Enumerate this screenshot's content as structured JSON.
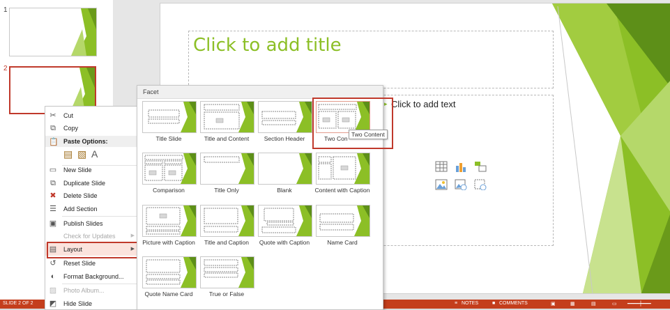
{
  "thumbnails": [
    {
      "number": "1",
      "selected": false
    },
    {
      "number": "2",
      "selected": true
    }
  ],
  "slide": {
    "title_placeholder": "Click to add title",
    "body_placeholder": "Click to add text",
    "content_icons": [
      "table-icon",
      "chart-icon",
      "smartart-icon",
      "picture-icon",
      "online-picture-icon",
      "video-icon"
    ]
  },
  "context_menu": {
    "items": [
      {
        "label": "Cut",
        "icon": "scissors-icon",
        "enabled": true
      },
      {
        "label": "Copy",
        "icon": "copy-icon",
        "enabled": true
      },
      {
        "label": "Paste Options:",
        "icon": "paste-icon",
        "enabled": true
      },
      {
        "label": "New Slide",
        "icon": "new-slide-icon",
        "enabled": true
      },
      {
        "label": "Duplicate Slide",
        "icon": "duplicate-icon",
        "enabled": true
      },
      {
        "label": "Delete Slide",
        "icon": "delete-slide-icon",
        "enabled": true
      },
      {
        "label": "Add Section",
        "icon": "section-icon",
        "enabled": true
      },
      {
        "label": "Publish Slides",
        "icon": "publish-icon",
        "enabled": true
      },
      {
        "label": "Check for Updates",
        "icon": "",
        "enabled": false
      },
      {
        "label": "Layout",
        "icon": "layout-icon",
        "enabled": true,
        "highlighted": true
      },
      {
        "label": "Reset Slide",
        "icon": "reset-icon",
        "enabled": true
      },
      {
        "label": "Format Background...",
        "icon": "format-background-icon",
        "enabled": true
      },
      {
        "label": "Photo Album...",
        "icon": "photo-album-icon",
        "enabled": false
      },
      {
        "label": "Hide Slide",
        "icon": "hide-slide-icon",
        "enabled": true
      }
    ]
  },
  "layout_gallery": {
    "header": "Facet",
    "layouts": [
      {
        "label": "Title Slide"
      },
      {
        "label": "Title and Content"
      },
      {
        "label": "Section Header"
      },
      {
        "label": "Two Content",
        "hovered": true
      },
      {
        "label": "Comparison"
      },
      {
        "label": "Title Only"
      },
      {
        "label": "Blank"
      },
      {
        "label": "Content with Caption"
      },
      {
        "label": "Picture with Caption"
      },
      {
        "label": "Title and Caption"
      },
      {
        "label": "Quote with Caption"
      },
      {
        "label": "Name Card"
      },
      {
        "label": "Quote Name Card"
      },
      {
        "label": "True or False"
      }
    ],
    "tooltip": "Two Content",
    "hover_caption": "Two Con"
  },
  "status_bar": {
    "slide_indicator": "SLIDE 2 OF 2",
    "notes": "NOTES",
    "comments": "COMMENTS"
  },
  "colors": {
    "accent_green": "#8cbf26",
    "status_bar": "#c43e1c",
    "highlight_red": "#c0392b"
  }
}
